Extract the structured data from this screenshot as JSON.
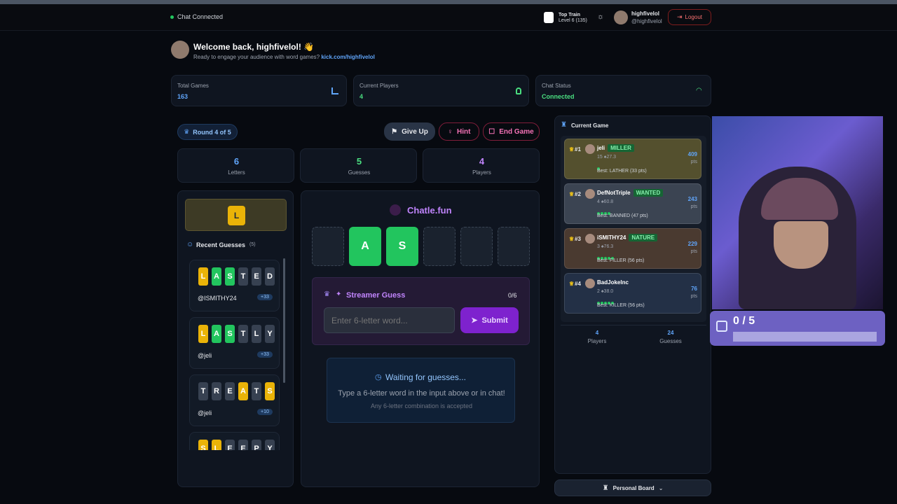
{
  "header": {
    "status": "Chat Connected",
    "train_title": "Top Train",
    "train_level": "Level 6 (135)",
    "username": "highfivelol",
    "handle": "@highfivelol",
    "logout": "Logout"
  },
  "welcome": {
    "title": "Welcome back, highfivelol! 👋",
    "subtitle": "Ready to engage your audience with word games?",
    "link": "kick.com/highfivelol"
  },
  "stats": [
    {
      "label": "Total Games",
      "value": "163"
    },
    {
      "label": "Current Players",
      "value": "4"
    },
    {
      "label": "Chat Status",
      "value": "Connected"
    }
  ],
  "round": "Round 4 of 5",
  "actions": {
    "give_up": "Give Up",
    "hint": "Hint",
    "end": "End Game"
  },
  "counters": [
    {
      "value": "6",
      "label": "Letters"
    },
    {
      "value": "5",
      "label": "Guesses"
    },
    {
      "value": "4",
      "label": "Players"
    }
  ],
  "hint_letter": "L",
  "recent": {
    "title": "Recent Guesses",
    "count": "(5)",
    "items": [
      {
        "letters": [
          "L",
          "A",
          "S",
          "T",
          "E",
          "D"
        ],
        "states": [
          "y",
          "g",
          "g",
          "n",
          "n",
          "n"
        ],
        "user": "@ISMITHY24",
        "pts": "+33"
      },
      {
        "letters": [
          "L",
          "A",
          "S",
          "T",
          "L",
          "Y"
        ],
        "states": [
          "y",
          "g",
          "g",
          "n",
          "n",
          "n"
        ],
        "user": "@jeli",
        "pts": "+33"
      },
      {
        "letters": [
          "T",
          "R",
          "E",
          "A",
          "T",
          "S"
        ],
        "states": [
          "n",
          "n",
          "n",
          "y",
          "n",
          "y"
        ],
        "user": "@jeli",
        "pts": "+10"
      },
      {
        "letters": [
          "S",
          "L",
          "E",
          "E",
          "P",
          "Y"
        ],
        "states": [
          "y",
          "y",
          "n",
          "n",
          "n",
          "n"
        ],
        "user": "",
        "pts": ""
      }
    ]
  },
  "game": {
    "brand": "Chatle.fun",
    "slots": [
      "",
      "A",
      "S",
      "",
      "",
      ""
    ],
    "streamer_title": "Streamer Guess",
    "streamer_count": "0/6",
    "input_placeholder": "Enter 6-letter word...",
    "submit": "Submit",
    "waiting_title": "Waiting for guesses...",
    "waiting_line1": "Type a 6-letter word in the input above or in chat!",
    "waiting_line2": "Any 6-letter combination is accepted"
  },
  "current": {
    "title": "Current Game",
    "players": [
      {
        "rank": "#1",
        "name": "jeli",
        "tag": "MILLER",
        "stats": "15 ♠27.3",
        "best": "Best: LATHER (33 pts)",
        "pts": "409",
        "bg": "#54502e",
        "pips": 1
      },
      {
        "rank": "#2",
        "name": "DefNotTriple",
        "tag": "WANTED",
        "stats": "4 ♠60.8",
        "best": "Best: BANNED (47 pts)",
        "pts": "243",
        "bg": "#3b4452",
        "pips": 4
      },
      {
        "rank": "#3",
        "name": "iSMITHY24",
        "tag": "NATURE",
        "stats": "3 ♠76.3",
        "best": "Best: FILLER (56 pts)",
        "pts": "229",
        "bg": "#4a3a30",
        "pips": 5
      },
      {
        "rank": "#4",
        "name": "BadJokeInc",
        "tag": "",
        "stats": "2 ♠38.0",
        "best": "Best: KILLER (56 pts)",
        "pts": "76",
        "bg": "#233046",
        "pips": 5
      }
    ],
    "footer_players_value": "4",
    "footer_players_label": "Players",
    "footer_guesses_value": "24",
    "footer_guesses_label": "Guesses",
    "pts_unit": "pts"
  },
  "personal_board": "Personal Board",
  "overlay": {
    "progress": "0 / 5"
  }
}
